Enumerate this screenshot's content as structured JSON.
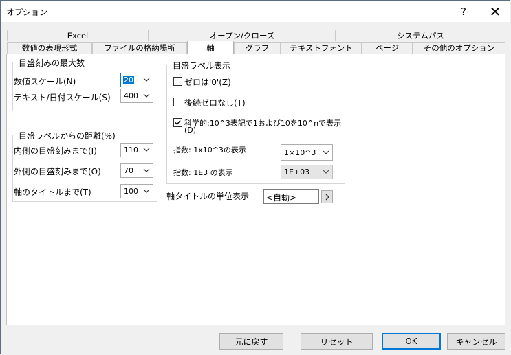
{
  "window": {
    "title": "オプション",
    "help_glyph": "?",
    "close_glyph": "✕"
  },
  "tabs_top": [
    "Excel",
    "オープン/クローズ",
    "システムパス"
  ],
  "tabs_bottom": [
    "数値の表現形式",
    "ファイルの格納場所",
    "軸",
    "グラフ",
    "テキストフォント",
    "ページ",
    "その他のオプション"
  ],
  "active_tab": "軸",
  "tick_max": {
    "legend": "目盛刻みの最大数",
    "numeric_label": "数値スケール(N)",
    "numeric_value": "20",
    "text_label": "テキスト/日付スケール(S)",
    "text_value": "400"
  },
  "label_distance": {
    "legend": "目盛ラベルからの距離(%)",
    "inner_label": "内側の目盛刻みまで(I)",
    "inner_value": "110",
    "outer_label": "外側の目盛刻みまで(O)",
    "outer_value": "70",
    "title_label": "軸のタイトルまで(T)",
    "title_value": "100"
  },
  "tick_label_display": {
    "legend": "目盛ラベル表示",
    "zero_label": "ゼロは'0'(Z)",
    "zero_checked": false,
    "trailing_zero_label": "後続ゼロなし(T)",
    "trailing_zero_checked": false,
    "scientific_label_line1": "科学的:10^3表記で1および10を10^nで表示",
    "scientific_label_line2": "(D)",
    "scientific_checked": true,
    "exp1_label": "指数: 1x10^3の表示",
    "exp1_value": "1×10^3",
    "exp2_label": "指数: 1E3 の表示",
    "exp2_value": "1E+03"
  },
  "axis_title_unit": {
    "label": "軸タイトルの単位表示",
    "value": "<自動>"
  },
  "buttons": {
    "revert": "元に戻す",
    "reset": "リセット",
    "ok": "OK",
    "cancel": "キャンセル"
  },
  "colors": {
    "accent": "#0078d7",
    "panel_bg": "#ffffff",
    "window_bg": "#f0f0f0"
  }
}
